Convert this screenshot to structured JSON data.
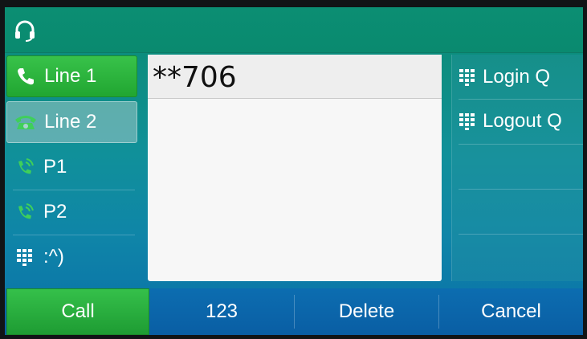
{
  "status_bar": {
    "icon": "headset-icon"
  },
  "lines": [
    {
      "label": "Line 1",
      "icon": "phone-handset-icon",
      "state": "active",
      "color": "#2db341"
    },
    {
      "label": "Line 2",
      "icon": "desk-phone-icon",
      "state": "selected",
      "color": "#3fcf5a"
    },
    {
      "label": "P1",
      "icon": "ringing-phone-icon",
      "color": "#3fcf5a"
    },
    {
      "label": "P2",
      "icon": "ringing-phone-icon",
      "color": "#3fcf5a"
    },
    {
      "label": ":^)",
      "icon": "keypad-icon"
    }
  ],
  "dial_input": {
    "value": "**706"
  },
  "right_keys": [
    {
      "label": "Login Q",
      "icon": "keypad-icon"
    },
    {
      "label": "Logout Q",
      "icon": "keypad-icon"
    }
  ],
  "softkeys": {
    "call": "Call",
    "input_mode": "123",
    "delete": "Delete",
    "cancel": "Cancel"
  },
  "colors": {
    "call_green": "#2bb440",
    "softkey_blue": "#0b66ab",
    "screen_teal": "#0a8c72"
  }
}
